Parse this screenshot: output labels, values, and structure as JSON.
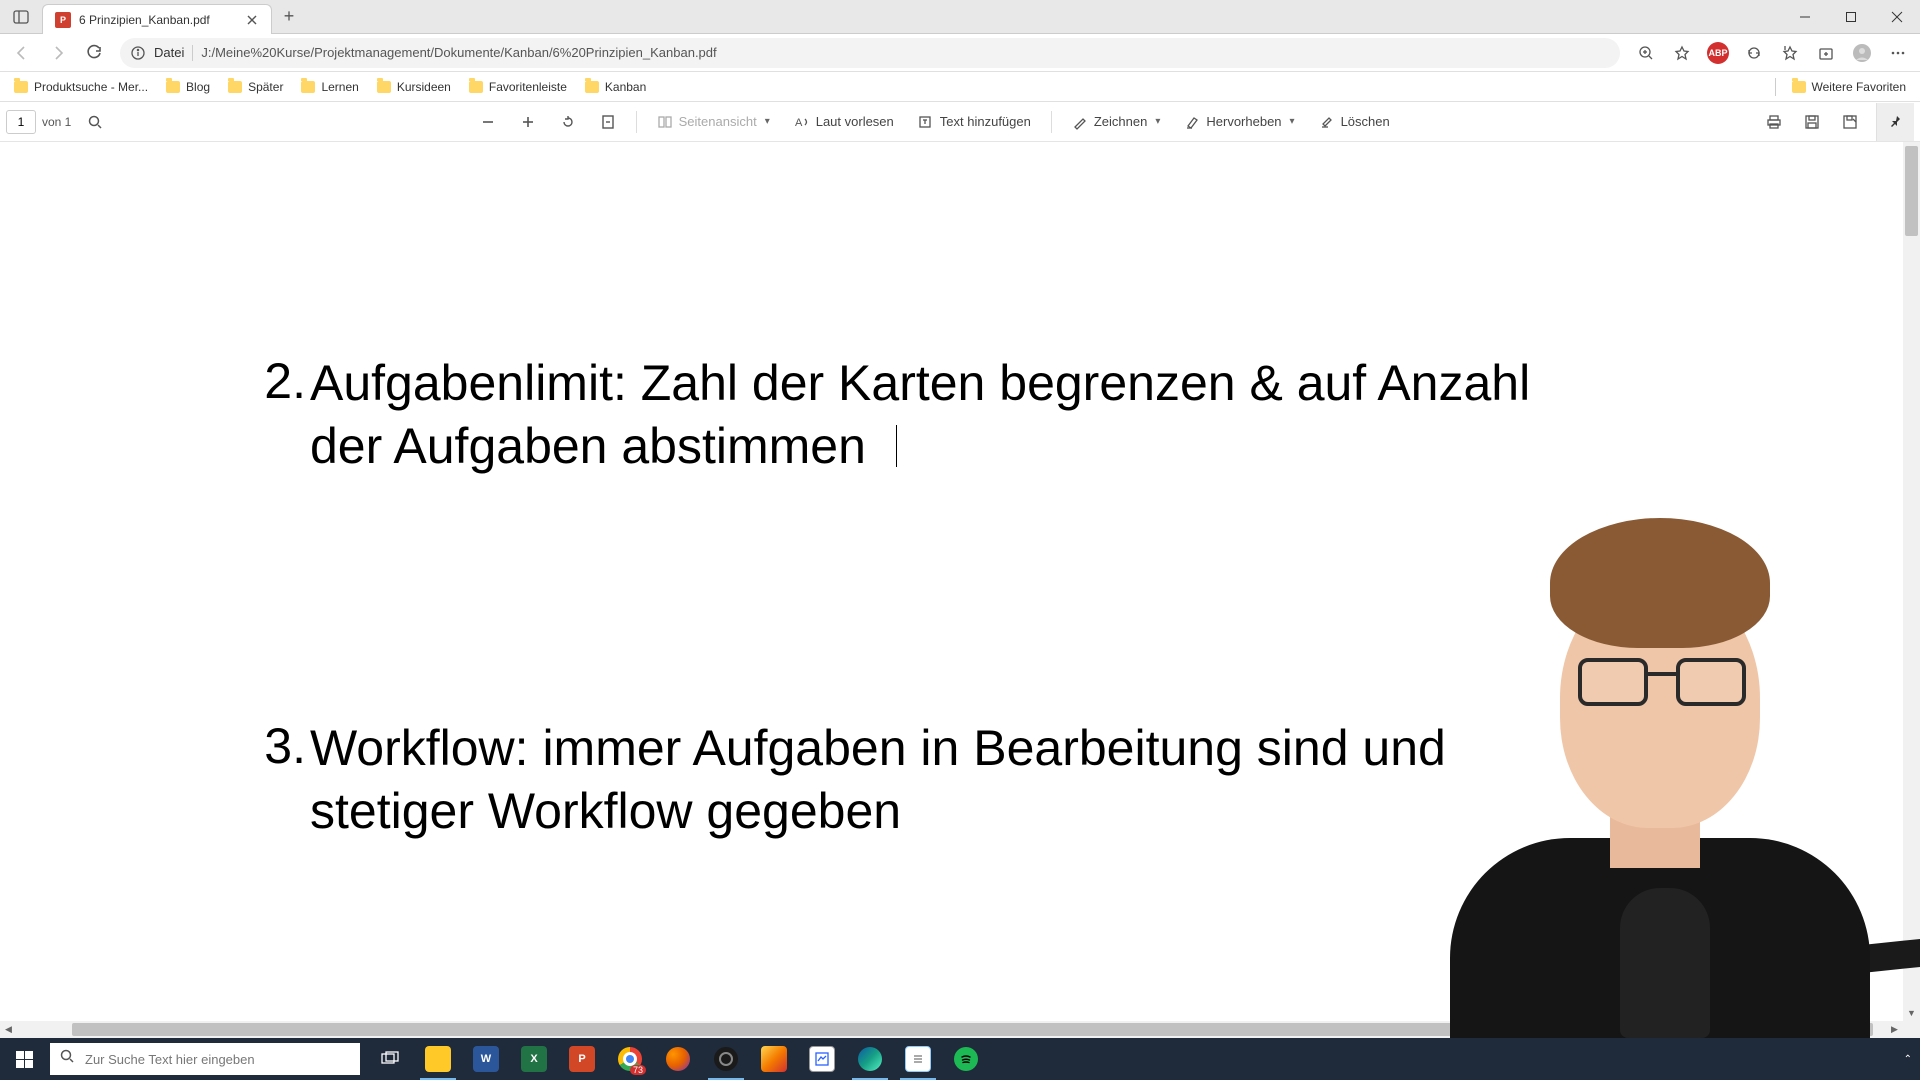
{
  "window": {
    "tab_title": "6 Prinzipien_Kanban.pdf"
  },
  "address": {
    "protocol_label": "Datei",
    "url": "J:/Meine%20Kurse/Projektmanagement/Dokumente/Kanban/6%20Prinzipien_Kanban.pdf"
  },
  "bookmarks": {
    "items": [
      {
        "label": "Produktsuche - Mer..."
      },
      {
        "label": "Blog"
      },
      {
        "label": "Später"
      },
      {
        "label": "Lernen"
      },
      {
        "label": "Kursideen"
      },
      {
        "label": "Favoritenleiste"
      },
      {
        "label": "Kanban"
      }
    ],
    "more_label": "Weitere Favoriten"
  },
  "pdfbar": {
    "page_current": "1",
    "page_of": "von 1",
    "page_view": "Seitenansicht",
    "read_aloud": "Laut vorlesen",
    "add_text": "Text hinzufügen",
    "draw": "Zeichnen",
    "highlight": "Hervorheben",
    "erase": "Löschen"
  },
  "content": {
    "item2_num": "2.",
    "item2_text": "Aufgabenlimit: Zahl der Karten begrenzen & auf Anzahl der Aufgaben abstimmen",
    "item3_num": "3.",
    "item3_text": "Workflow: immer Aufgaben in Bearbeitung sind und stetiger Workflow gegeben"
  },
  "taskbar": {
    "search_placeholder": "Zur Suche Text hier eingeben",
    "chrome_badge": "73"
  },
  "extension": {
    "abp": "ABP"
  }
}
